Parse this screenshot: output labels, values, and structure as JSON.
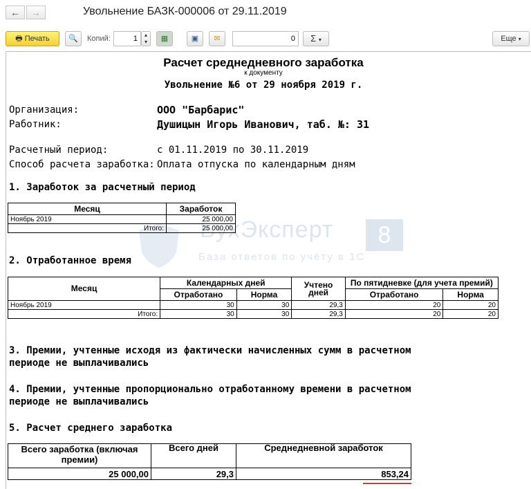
{
  "window": {
    "title": "Увольнение БАЗК-000006 от 29.11.2019"
  },
  "toolbar": {
    "print_label": "Печать",
    "copies_label": "Копий:",
    "copies_value": "1",
    "sum_value": "0",
    "sigma_label": "Σ",
    "more_label": "Еще"
  },
  "watermark": {
    "brand": "БухЭксперт",
    "badge": "8",
    "tagline": "База ответов по учёту в 1С"
  },
  "report": {
    "title": "Расчет среднедневного заработка",
    "subtitle": "к документу",
    "document": "Увольнение №6 от 29 ноября 2019 г.",
    "org_label": "Организация:",
    "org_value": "ООО \"Барбарис\"",
    "worker_label": "Работник:",
    "worker_value": "Душицын Игорь Иванович, таб. №: 31",
    "period_label": "Расчетный период:",
    "period_value": "с 01.11.2019 по 30.11.2019",
    "method_label": "Способ расчета заработка:",
    "method_value": "Оплата отпуска по календарным дням",
    "s1": "1. Заработок за расчетный период",
    "s2": "2. Отработанное время",
    "s3a": "3. Премии, учтенные исходя из фактически начисленных сумм в расчетном",
    "s3b": "периоде не выплачивались",
    "s4a": "4. Премии, учтенные пропорционально отработанному времени в расчетном",
    "s4b": "периоде не выплачивались",
    "s5": "5. Расчет среднего  заработка"
  },
  "t1": {
    "h_month": "Месяц",
    "h_earn": "Заработок",
    "month": "Ноябрь 2019",
    "earn": "25 000,00",
    "total_label": "Итого:",
    "total": "25 000,00"
  },
  "t2": {
    "h_month": "Месяц",
    "h_cal": "Календарных дней",
    "h_counted": "Учтено дней",
    "h_five": "По пятидневке (для учета премий)",
    "h_worked": "Отработано",
    "h_norm": "Норма",
    "h_worked2": "Отработано",
    "h_norm2": "Норма",
    "month": "Ноябрь 2019",
    "worked": "30",
    "norm": "30",
    "counted": "29,3",
    "worked2": "20",
    "norm2": "20",
    "total_label": "Итого:",
    "t_worked": "30",
    "t_norm": "30",
    "t_counted": "29,3",
    "t_worked2": "20",
    "t_norm2": "20"
  },
  "t3": {
    "h_total": "Всего заработка (включая премии)",
    "h_days": "Всего дней",
    "h_avg": "Среднедневной заработок",
    "total": "25 000,00",
    "days": "29,3",
    "avg": "853,24"
  },
  "colors": {
    "print_btn": "#f2d233",
    "underline": "#e03030",
    "watermark": "#dde5ef"
  }
}
